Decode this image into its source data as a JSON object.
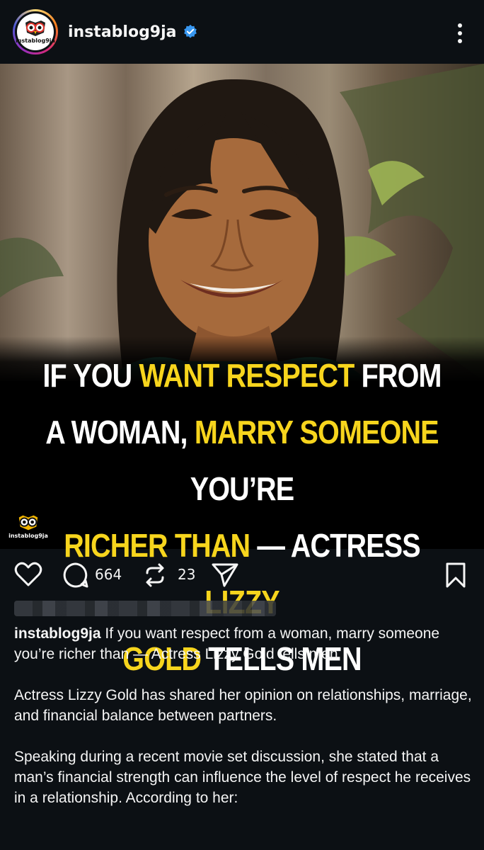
{
  "header": {
    "username": "instablog9ja",
    "avatar_text": "instablog9ja",
    "verified_icon": "verified-badge-icon",
    "more_icon": "more-vertical-icon",
    "brand_color": "#3897f0"
  },
  "post": {
    "headline": {
      "line1_a": "IF YOU ",
      "line1_b": "WANT RESPECT",
      "line1_c": " FROM",
      "line2_a": "A WOMAN, ",
      "line2_b": "MARRY SOMEONE",
      "line2_c": " YOU’RE",
      "line3_a": "RICHER THAN",
      "line3_b": " — ACTRESS ",
      "line3_c": "LIZZY",
      "line4_a": "GOLD",
      "line4_b": " TELLS MEN"
    },
    "watermark_text": "instablog9ja",
    "highlight_color": "#f7d51d"
  },
  "actions": {
    "comments_count": "664",
    "reposts_count": "23",
    "icons": [
      "heart-icon",
      "comment-icon",
      "repost-icon",
      "share-icon",
      "bookmark-icon"
    ]
  },
  "caption": {
    "username": "instablog9ja",
    "title": " If you want respect from a woman, marry someone you’re richer than — Actress Lizzy Gold tells men",
    "paragraph1": "Actress Lizzy Gold has shared her opinion on relationships, marriage, and financial balance between partners.",
    "paragraph2": "Speaking during a recent movie set discussion, she stated that a man’s financial strength can influence the level of respect he receives in a relationship. According to her:"
  }
}
